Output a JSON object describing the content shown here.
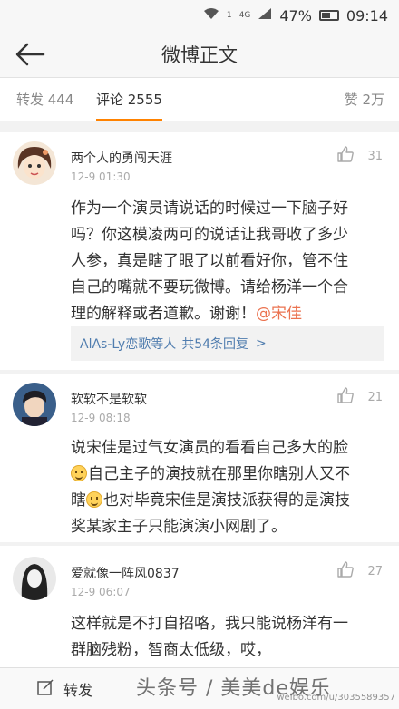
{
  "status": {
    "signal": "4G",
    "battery": "47%",
    "time": "09:14",
    "badge": "1"
  },
  "nav": {
    "title": "微博正文"
  },
  "tabs": {
    "repost": "转发 444",
    "comment": "评论 2555",
    "like": "赞 2万"
  },
  "comments": [
    {
      "name": "两个人的勇闯天涯",
      "time": "12-9 01:30",
      "likes": "31",
      "text_lines": [
        "作为一个演员请说话的时候过一下脑子好",
        "吗？你这模凌两可的说话让我哥收了多少",
        "人参，真是瞎了眼了以前看好你，管不住",
        "自己的嘴就不要玩微博。请给杨洋一个合"
      ],
      "text_last": "理的解释或者道歉。谢谢！",
      "mention": "@宋佳",
      "replies_from": "AlAs-Ly恋歌等人",
      "replies_count": "共54条回复",
      "replies_arrow": ">"
    },
    {
      "name": "软软不是软软",
      "time": "12-9 08:18",
      "likes": "21",
      "line1": "说宋佳是过气女演员的看看自己多大的脸",
      "line2": "自己主子的演技就在那里你瞎别人又不",
      "line3a": "瞎",
      "line3b": "也对毕竟宋佳是演技派获得的是演技",
      "line4": "奖某家主子只能演演小网剧了。"
    },
    {
      "name": "爱就像一阵风0837",
      "time": "12-9 06:07",
      "likes": "27",
      "text_lines": [
        "这样就是不打自招咯，我只能说杨洋有一",
        "群脑残粉，智商太低级，哎，"
      ]
    }
  ],
  "bottom": {
    "repost": "转发"
  },
  "watermark": {
    "text": "头条号 / 美美de娱乐",
    "url": "weibo.com/u/3035589357"
  },
  "colors": {
    "accent": "#ff8200",
    "link": "#507daf",
    "mention": "#eb7350"
  }
}
